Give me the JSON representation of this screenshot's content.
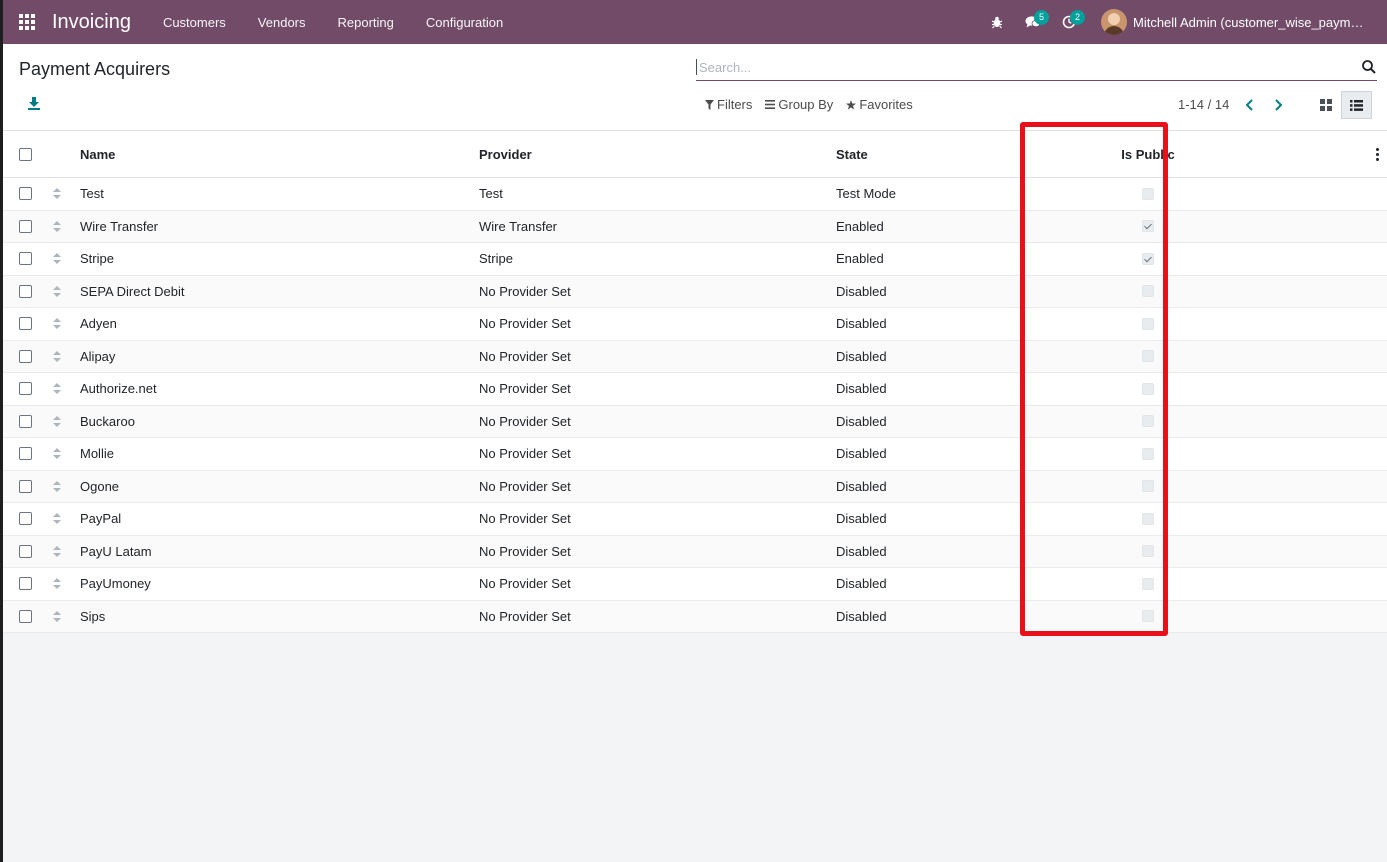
{
  "navbar": {
    "app_name": "Invoicing",
    "menu": [
      "Customers",
      "Vendors",
      "Reporting",
      "Configuration"
    ],
    "messages_badge": "5",
    "activities_badge": "2",
    "user_name": "Mitchell Admin (customer_wise_payme…",
    "icons": [
      "apps-grid-icon",
      "bug-icon",
      "chat-icon",
      "clock-icon"
    ],
    "background_color": "#714b67"
  },
  "control_panel": {
    "title": "Payment Acquirers",
    "search_placeholder": "Search...",
    "filters_label": "Filters",
    "group_by_label": "Group By",
    "favorites_label": "Favorites",
    "pager": "1-14 / 14"
  },
  "table": {
    "columns": [
      "Name",
      "Provider",
      "State",
      "Is Public"
    ],
    "rows": [
      {
        "name": "Test",
        "provider": "Test",
        "state": "Test Mode",
        "is_public": false
      },
      {
        "name": "Wire Transfer",
        "provider": "Wire Transfer",
        "state": "Enabled",
        "is_public": true
      },
      {
        "name": "Stripe",
        "provider": "Stripe",
        "state": "Enabled",
        "is_public": true
      },
      {
        "name": "SEPA Direct Debit",
        "provider": "No Provider Set",
        "state": "Disabled",
        "is_public": false
      },
      {
        "name": "Adyen",
        "provider": "No Provider Set",
        "state": "Disabled",
        "is_public": false
      },
      {
        "name": "Alipay",
        "provider": "No Provider Set",
        "state": "Disabled",
        "is_public": false
      },
      {
        "name": "Authorize.net",
        "provider": "No Provider Set",
        "state": "Disabled",
        "is_public": false
      },
      {
        "name": "Buckaroo",
        "provider": "No Provider Set",
        "state": "Disabled",
        "is_public": false
      },
      {
        "name": "Mollie",
        "provider": "No Provider Set",
        "state": "Disabled",
        "is_public": false
      },
      {
        "name": "Ogone",
        "provider": "No Provider Set",
        "state": "Disabled",
        "is_public": false
      },
      {
        "name": "PayPal",
        "provider": "No Provider Set",
        "state": "Disabled",
        "is_public": false
      },
      {
        "name": "PayU Latam",
        "provider": "No Provider Set",
        "state": "Disabled",
        "is_public": false
      },
      {
        "name": "PayUmoney",
        "provider": "No Provider Set",
        "state": "Disabled",
        "is_public": false
      },
      {
        "name": "Sips",
        "provider": "No Provider Set",
        "state": "Disabled",
        "is_public": false
      }
    ]
  },
  "highlight_color": "#e8101a",
  "accent_color": "#00a09d"
}
